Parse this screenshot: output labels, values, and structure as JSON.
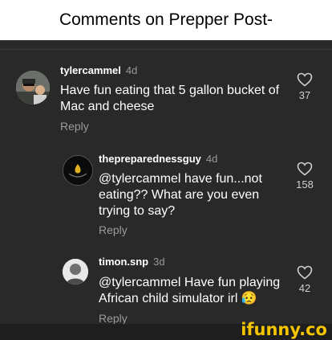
{
  "header": {
    "title": "Comments on Prepper Post-"
  },
  "comments": [
    {
      "username": "tylercammel",
      "age": "4d",
      "text_lines": [
        "Have fun eating that 5 gallon bucket of",
        "Mac and cheese"
      ],
      "reply_label": "Reply",
      "likes": "37"
    },
    {
      "username": "thepreparednessguy",
      "age": "4d",
      "text_lines": [
        "@tylercammel have fun...not",
        "eating?? What are you even",
        "trying to say?"
      ],
      "reply_label": "Reply",
      "likes": "158"
    },
    {
      "username": "timon.snp",
      "age": "3d",
      "text_lines": [
        "@tylercammel Have fun playing",
        "African child simulator irl"
      ],
      "emoji": "😥",
      "reply_label": "Reply",
      "likes": "42"
    }
  ],
  "watermark": {
    "text": "ifunny.co"
  },
  "colors": {
    "background": "#292929",
    "muted_text": "#9a9a9a",
    "watermark": "#f5c400"
  }
}
